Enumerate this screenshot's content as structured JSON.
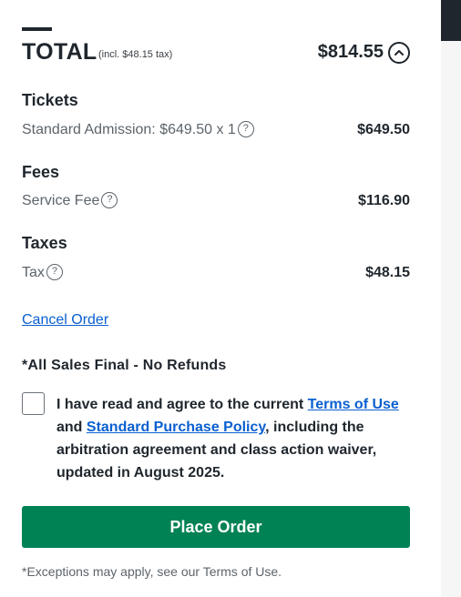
{
  "summary": {
    "total_label": "TOTAL",
    "total_tax_note": "(incl. $48.15 tax)",
    "total_amount": "$814.55"
  },
  "tickets": {
    "title": "Tickets",
    "item_label": "Standard Admission: $649.50 x 1",
    "item_amount": "$649.50"
  },
  "fees": {
    "title": "Fees",
    "item_label": "Service Fee",
    "item_amount": "$116.90"
  },
  "taxes": {
    "title": "Taxes",
    "item_label": "Tax",
    "item_amount": "$48.15"
  },
  "help_glyph": "?",
  "cancel_label": "Cancel Order",
  "sales_final": "*All Sales Final - No Refunds",
  "agreement": {
    "checked": false,
    "prefix": "I have read and agree to the current ",
    "terms_link": "Terms of Use",
    "and": " and ",
    "policy_link": "Standard Purchase Policy",
    "suffix": ", including the arbitration agreement and class action waiver, updated in August 2025."
  },
  "place_order_label": "Place Order",
  "exceptions_note": "*Exceptions may apply, see our Terms of Use.",
  "colors": {
    "primary_button": "#008254",
    "link": "#0a5fd0",
    "text": "#1f262d",
    "muted_text": "#5c646b"
  },
  "icons": {
    "collapse": "chevron-up-icon",
    "help": "question-circle-icon"
  }
}
